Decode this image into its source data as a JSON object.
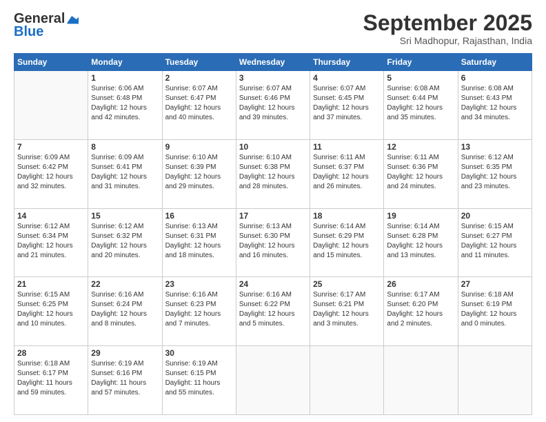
{
  "header": {
    "logo_general": "General",
    "logo_blue": "Blue",
    "month_title": "September 2025",
    "location": "Sri Madhopur, Rajasthan, India"
  },
  "calendar": {
    "days_of_week": [
      "Sunday",
      "Monday",
      "Tuesday",
      "Wednesday",
      "Thursday",
      "Friday",
      "Saturday"
    ],
    "weeks": [
      [
        {
          "day": null,
          "sunrise": null,
          "sunset": null,
          "daylight": null
        },
        {
          "day": "1",
          "sunrise": "6:06 AM",
          "sunset": "6:48 PM",
          "daylight": "12 hours and 42 minutes."
        },
        {
          "day": "2",
          "sunrise": "6:07 AM",
          "sunset": "6:47 PM",
          "daylight": "12 hours and 40 minutes."
        },
        {
          "day": "3",
          "sunrise": "6:07 AM",
          "sunset": "6:46 PM",
          "daylight": "12 hours and 39 minutes."
        },
        {
          "day": "4",
          "sunrise": "6:07 AM",
          "sunset": "6:45 PM",
          "daylight": "12 hours and 37 minutes."
        },
        {
          "day": "5",
          "sunrise": "6:08 AM",
          "sunset": "6:44 PM",
          "daylight": "12 hours and 35 minutes."
        },
        {
          "day": "6",
          "sunrise": "6:08 AM",
          "sunset": "6:43 PM",
          "daylight": "12 hours and 34 minutes."
        }
      ],
      [
        {
          "day": "7",
          "sunrise": "6:09 AM",
          "sunset": "6:42 PM",
          "daylight": "12 hours and 32 minutes."
        },
        {
          "day": "8",
          "sunrise": "6:09 AM",
          "sunset": "6:41 PM",
          "daylight": "12 hours and 31 minutes."
        },
        {
          "day": "9",
          "sunrise": "6:10 AM",
          "sunset": "6:39 PM",
          "daylight": "12 hours and 29 minutes."
        },
        {
          "day": "10",
          "sunrise": "6:10 AM",
          "sunset": "6:38 PM",
          "daylight": "12 hours and 28 minutes."
        },
        {
          "day": "11",
          "sunrise": "6:11 AM",
          "sunset": "6:37 PM",
          "daylight": "12 hours and 26 minutes."
        },
        {
          "day": "12",
          "sunrise": "6:11 AM",
          "sunset": "6:36 PM",
          "daylight": "12 hours and 24 minutes."
        },
        {
          "day": "13",
          "sunrise": "6:12 AM",
          "sunset": "6:35 PM",
          "daylight": "12 hours and 23 minutes."
        }
      ],
      [
        {
          "day": "14",
          "sunrise": "6:12 AM",
          "sunset": "6:34 PM",
          "daylight": "12 hours and 21 minutes."
        },
        {
          "day": "15",
          "sunrise": "6:12 AM",
          "sunset": "6:32 PM",
          "daylight": "12 hours and 20 minutes."
        },
        {
          "day": "16",
          "sunrise": "6:13 AM",
          "sunset": "6:31 PM",
          "daylight": "12 hours and 18 minutes."
        },
        {
          "day": "17",
          "sunrise": "6:13 AM",
          "sunset": "6:30 PM",
          "daylight": "12 hours and 16 minutes."
        },
        {
          "day": "18",
          "sunrise": "6:14 AM",
          "sunset": "6:29 PM",
          "daylight": "12 hours and 15 minutes."
        },
        {
          "day": "19",
          "sunrise": "6:14 AM",
          "sunset": "6:28 PM",
          "daylight": "12 hours and 13 minutes."
        },
        {
          "day": "20",
          "sunrise": "6:15 AM",
          "sunset": "6:27 PM",
          "daylight": "12 hours and 11 minutes."
        }
      ],
      [
        {
          "day": "21",
          "sunrise": "6:15 AM",
          "sunset": "6:25 PM",
          "daylight": "12 hours and 10 minutes."
        },
        {
          "day": "22",
          "sunrise": "6:16 AM",
          "sunset": "6:24 PM",
          "daylight": "12 hours and 8 minutes."
        },
        {
          "day": "23",
          "sunrise": "6:16 AM",
          "sunset": "6:23 PM",
          "daylight": "12 hours and 7 minutes."
        },
        {
          "day": "24",
          "sunrise": "6:16 AM",
          "sunset": "6:22 PM",
          "daylight": "12 hours and 5 minutes."
        },
        {
          "day": "25",
          "sunrise": "6:17 AM",
          "sunset": "6:21 PM",
          "daylight": "12 hours and 3 minutes."
        },
        {
          "day": "26",
          "sunrise": "6:17 AM",
          "sunset": "6:20 PM",
          "daylight": "12 hours and 2 minutes."
        },
        {
          "day": "27",
          "sunrise": "6:18 AM",
          "sunset": "6:19 PM",
          "daylight": "12 hours and 0 minutes."
        }
      ],
      [
        {
          "day": "28",
          "sunrise": "6:18 AM",
          "sunset": "6:17 PM",
          "daylight": "11 hours and 59 minutes."
        },
        {
          "day": "29",
          "sunrise": "6:19 AM",
          "sunset": "6:16 PM",
          "daylight": "11 hours and 57 minutes."
        },
        {
          "day": "30",
          "sunrise": "6:19 AM",
          "sunset": "6:15 PM",
          "daylight": "11 hours and 55 minutes."
        },
        {
          "day": null,
          "sunrise": null,
          "sunset": null,
          "daylight": null
        },
        {
          "day": null,
          "sunrise": null,
          "sunset": null,
          "daylight": null
        },
        {
          "day": null,
          "sunrise": null,
          "sunset": null,
          "daylight": null
        },
        {
          "day": null,
          "sunrise": null,
          "sunset": null,
          "daylight": null
        }
      ]
    ]
  }
}
